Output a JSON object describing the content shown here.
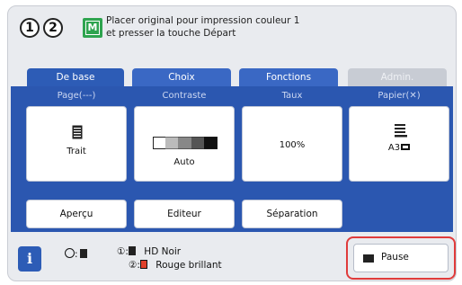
{
  "message": {
    "step1": "1",
    "step2": "2",
    "mode_icon": "M",
    "line1": "Placer original pour impression couleur 1",
    "line2": "et presser la touche Départ"
  },
  "tabs": {
    "basic": "De base",
    "choice": "Choix",
    "functions": "Fonctions",
    "admin": "Admin."
  },
  "columns": {
    "page": "Page(---)",
    "contrast": "Contraste",
    "ratio": "Taux",
    "paper": "Papier(✕)"
  },
  "tiles": {
    "page_value": "Trait",
    "contrast_value": "Auto",
    "ratio_value": "100%",
    "paper_value": "A3"
  },
  "buttons": {
    "preview": "Aperçu",
    "editor": "Editeur",
    "separation": "Séparation",
    "pause": "Pause",
    "info": "i"
  },
  "status": {
    "drum1_label": "①:",
    "drum1_color": "HD Noir",
    "drum2_label": "②:",
    "drum2_color": "Rouge brillant",
    "accent_red": "#e0402a"
  }
}
